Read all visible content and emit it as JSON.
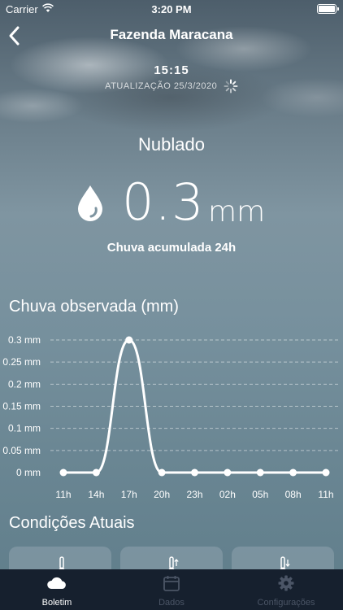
{
  "status_bar": {
    "carrier": "Carrier",
    "time": "3:20 PM"
  },
  "nav": {
    "title": "Fazenda Maracana"
  },
  "update": {
    "time": "15:15",
    "label": "ATUALIZAÇÃO 25/3/2020"
  },
  "weather": {
    "condition": "Nublado",
    "rain_value": "0.3",
    "rain_unit": "mm",
    "rain_label": "Chuva acumulada 24h"
  },
  "chart_title": "Chuva observada (mm)",
  "chart_data": {
    "type": "line",
    "title": "Chuva observada (mm)",
    "x": [
      "11h",
      "14h",
      "17h",
      "20h",
      "23h",
      "02h",
      "05h",
      "08h",
      "11h"
    ],
    "y_ticks": [
      "0.3 mm",
      "0.25 mm",
      "0.2 mm",
      "0.15 mm",
      "0.1 mm",
      "0.05 mm",
      "0 mm"
    ],
    "series": [
      {
        "values": [
          0,
          0,
          0.3,
          0,
          0,
          0,
          0,
          0,
          0
        ]
      }
    ],
    "ylim": [
      0,
      0.3
    ],
    "grid": true
  },
  "section_title": "Condições Atuais",
  "cards": [
    {
      "icon": "thermometer-icon"
    },
    {
      "icon": "thermometer-up-icon"
    },
    {
      "icon": "thermometer-down-icon"
    }
  ],
  "tabs": [
    {
      "label": "Boletim",
      "icon": "cloud-icon",
      "active": true
    },
    {
      "label": "Dados",
      "icon": "calendar-icon",
      "active": false
    },
    {
      "label": "Configurações",
      "icon": "gear-icon",
      "active": false
    }
  ]
}
